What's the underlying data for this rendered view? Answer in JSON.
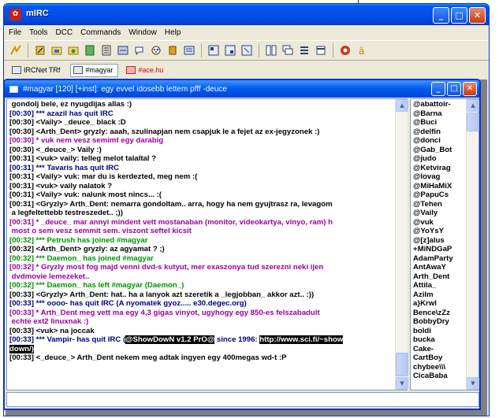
{
  "window": {
    "title": "mIRC",
    "buttons": {
      "min": "_",
      "max": "□",
      "close": "✕"
    }
  },
  "menu": [
    "File",
    "Tools",
    "DCC",
    "Commands",
    "Window",
    "Help"
  ],
  "toolbar": {
    "icons": [
      "connect-icon",
      "options-icon",
      "channels-folder-icon",
      "server-folder-icon",
      "scripts-icon",
      "address-book-icon",
      "dcc-send-icon",
      "dcc-chat-icon",
      "colors-icon",
      "notify-icon",
      "list-channels-icon",
      "finger-icon",
      "ident-icon",
      "timestamp-icon",
      "tile-icon",
      "cascade-icon",
      "arrange-icon",
      "online-timer-icon",
      "about-icon"
    ]
  },
  "switchbar": {
    "tabs": [
      {
        "label": "IRCNet TRf",
        "state": "normal"
      },
      {
        "label": "#magyar",
        "state": "active"
      },
      {
        "label": "#ace.hu",
        "state": "alert"
      }
    ]
  },
  "channel": {
    "title": "#magyar [120] [+inst]: egy evvel idosebb lettem pfff -deuce",
    "lines": [
      {
        "t": " gondolj bele, ez nyugdijas allas :)",
        "c": "text"
      },
      {
        "t": "[00:30] *** azazil has quit IRC",
        "c": "quit"
      },
      {
        "t": "[00:30] <Vaily> _deuce_ black :D",
        "c": "text"
      },
      {
        "t": "[00:30] <Arth_Dent> gryzly: aaah, szulinapjan nem csapjuk le a fejet az ex-jegyzonek :)",
        "c": "text"
      },
      {
        "t": "[00:30] * vuk nem vesz semimt egy darabig",
        "c": "action"
      },
      {
        "t": "[00:30] <_deuce_> Vaily :)",
        "c": "text"
      },
      {
        "t": "[00:31] <vuk> vaily: telleg melot talaltal ?",
        "c": "text"
      },
      {
        "t": "[00:31] *** Tavaris has quit IRC",
        "c": "quit"
      },
      {
        "t": "[00:31] <Vaily> vuk: mar du is kerdezted, meg nem :(",
        "c": "text"
      },
      {
        "t": "[00:31] <vuk> vaily nalatok ?",
        "c": "text"
      },
      {
        "t": "[00:31] <Vaily> vuk: nalunk most nincs... :(",
        "c": "text"
      },
      {
        "t": "[00:31] <Gryzly> Arth_Dent: nemarra gondoltam.. arra, hogy ha nem gyujtrasz ra, levagom\n a legfeltettebb testreszedet.. ;))",
        "c": "text"
      },
      {
        "t": "[00:31] * _deuce_ mar annyi mindent vett mostanaban (monitor, videokartya, vinyo, ram) h\n most o sem vesz semmit sem. viszont seftel kicsit",
        "c": "action"
      },
      {
        "t": "[00:32] *** Petrush has joined #magyar",
        "c": "join"
      },
      {
        "t": "[00:32] <Arth_Dent> gryzly: az agyamat ? ;)",
        "c": "text"
      },
      {
        "t": "[00:32] *** Daemon_ has joined #magyar",
        "c": "join"
      },
      {
        "t": "[00:32] * Gryzly most fog majd venni dvd-s kutyut, mer exaszonya tud szerezni neki ijen\n dvdmovie lemezeket..",
        "c": "action"
      },
      {
        "t": "[00:32] *** Daemon_ has left #magyar (Daemon_)",
        "c": "join"
      },
      {
        "t": "[00:33] <Gryzly> Arth_Dent: hat.. ha a lanyok azt szeretik a _legjobban_ akkor azt.. :))",
        "c": "text"
      },
      {
        "t": "[00:33] *** oooo- has quit IRC (A nyomatek gyoz..... e30.degec.org)",
        "c": "quit"
      },
      {
        "t": "[00:33] * Arth_Dent meg vett ma egy 4,3 gigas vinyot, ugyhogy egy 850-es felszabadult\n echte ext2 linuxnak :)",
        "c": "action"
      },
      {
        "t": "[00:33] <vuk> na joccak",
        "c": "text"
      },
      {
        "t": "[00:33] *** Vampir- has quit IRC (",
        "c": "quit",
        "hi1": "@ShowDowN v1.2 PrO@",
        "mid": " since 1996: ",
        "hi2": "http://www.sci.fi/~show\ndown/)"
      },
      {
        "t": "[00:33] <_deuce_> Arth_Dent nekem meg adtak ingyen egy 400megas wd-t :P",
        "c": "text"
      }
    ]
  },
  "nicklist": [
    "@abattoir-",
    "@Barna",
    "@Buci",
    "@delfin",
    "@donci",
    "@Gab_Bot",
    "@judo",
    "@Ketvirag",
    "@lovag",
    "@MiHaMiX",
    "@PapuCs",
    "@Tehen",
    "@Vaily",
    "@vuk",
    "@YoYsY",
    "@[z]alus",
    "+MiNDGaP",
    "AdamParty",
    "AntAwaY",
    "Arth_Dent",
    "Attila_",
    "Azilm",
    "a}Krwl",
    "Bence\\zZz",
    "BobbyDry",
    "boldi",
    "bucka",
    "Cake-",
    "CartBoy",
    "chybee\\\\\\",
    "CicaBaba"
  ],
  "colors": {
    "accent": "#0054e3",
    "join": "#009300",
    "quit": "#00007f",
    "action": "#9c009c"
  }
}
